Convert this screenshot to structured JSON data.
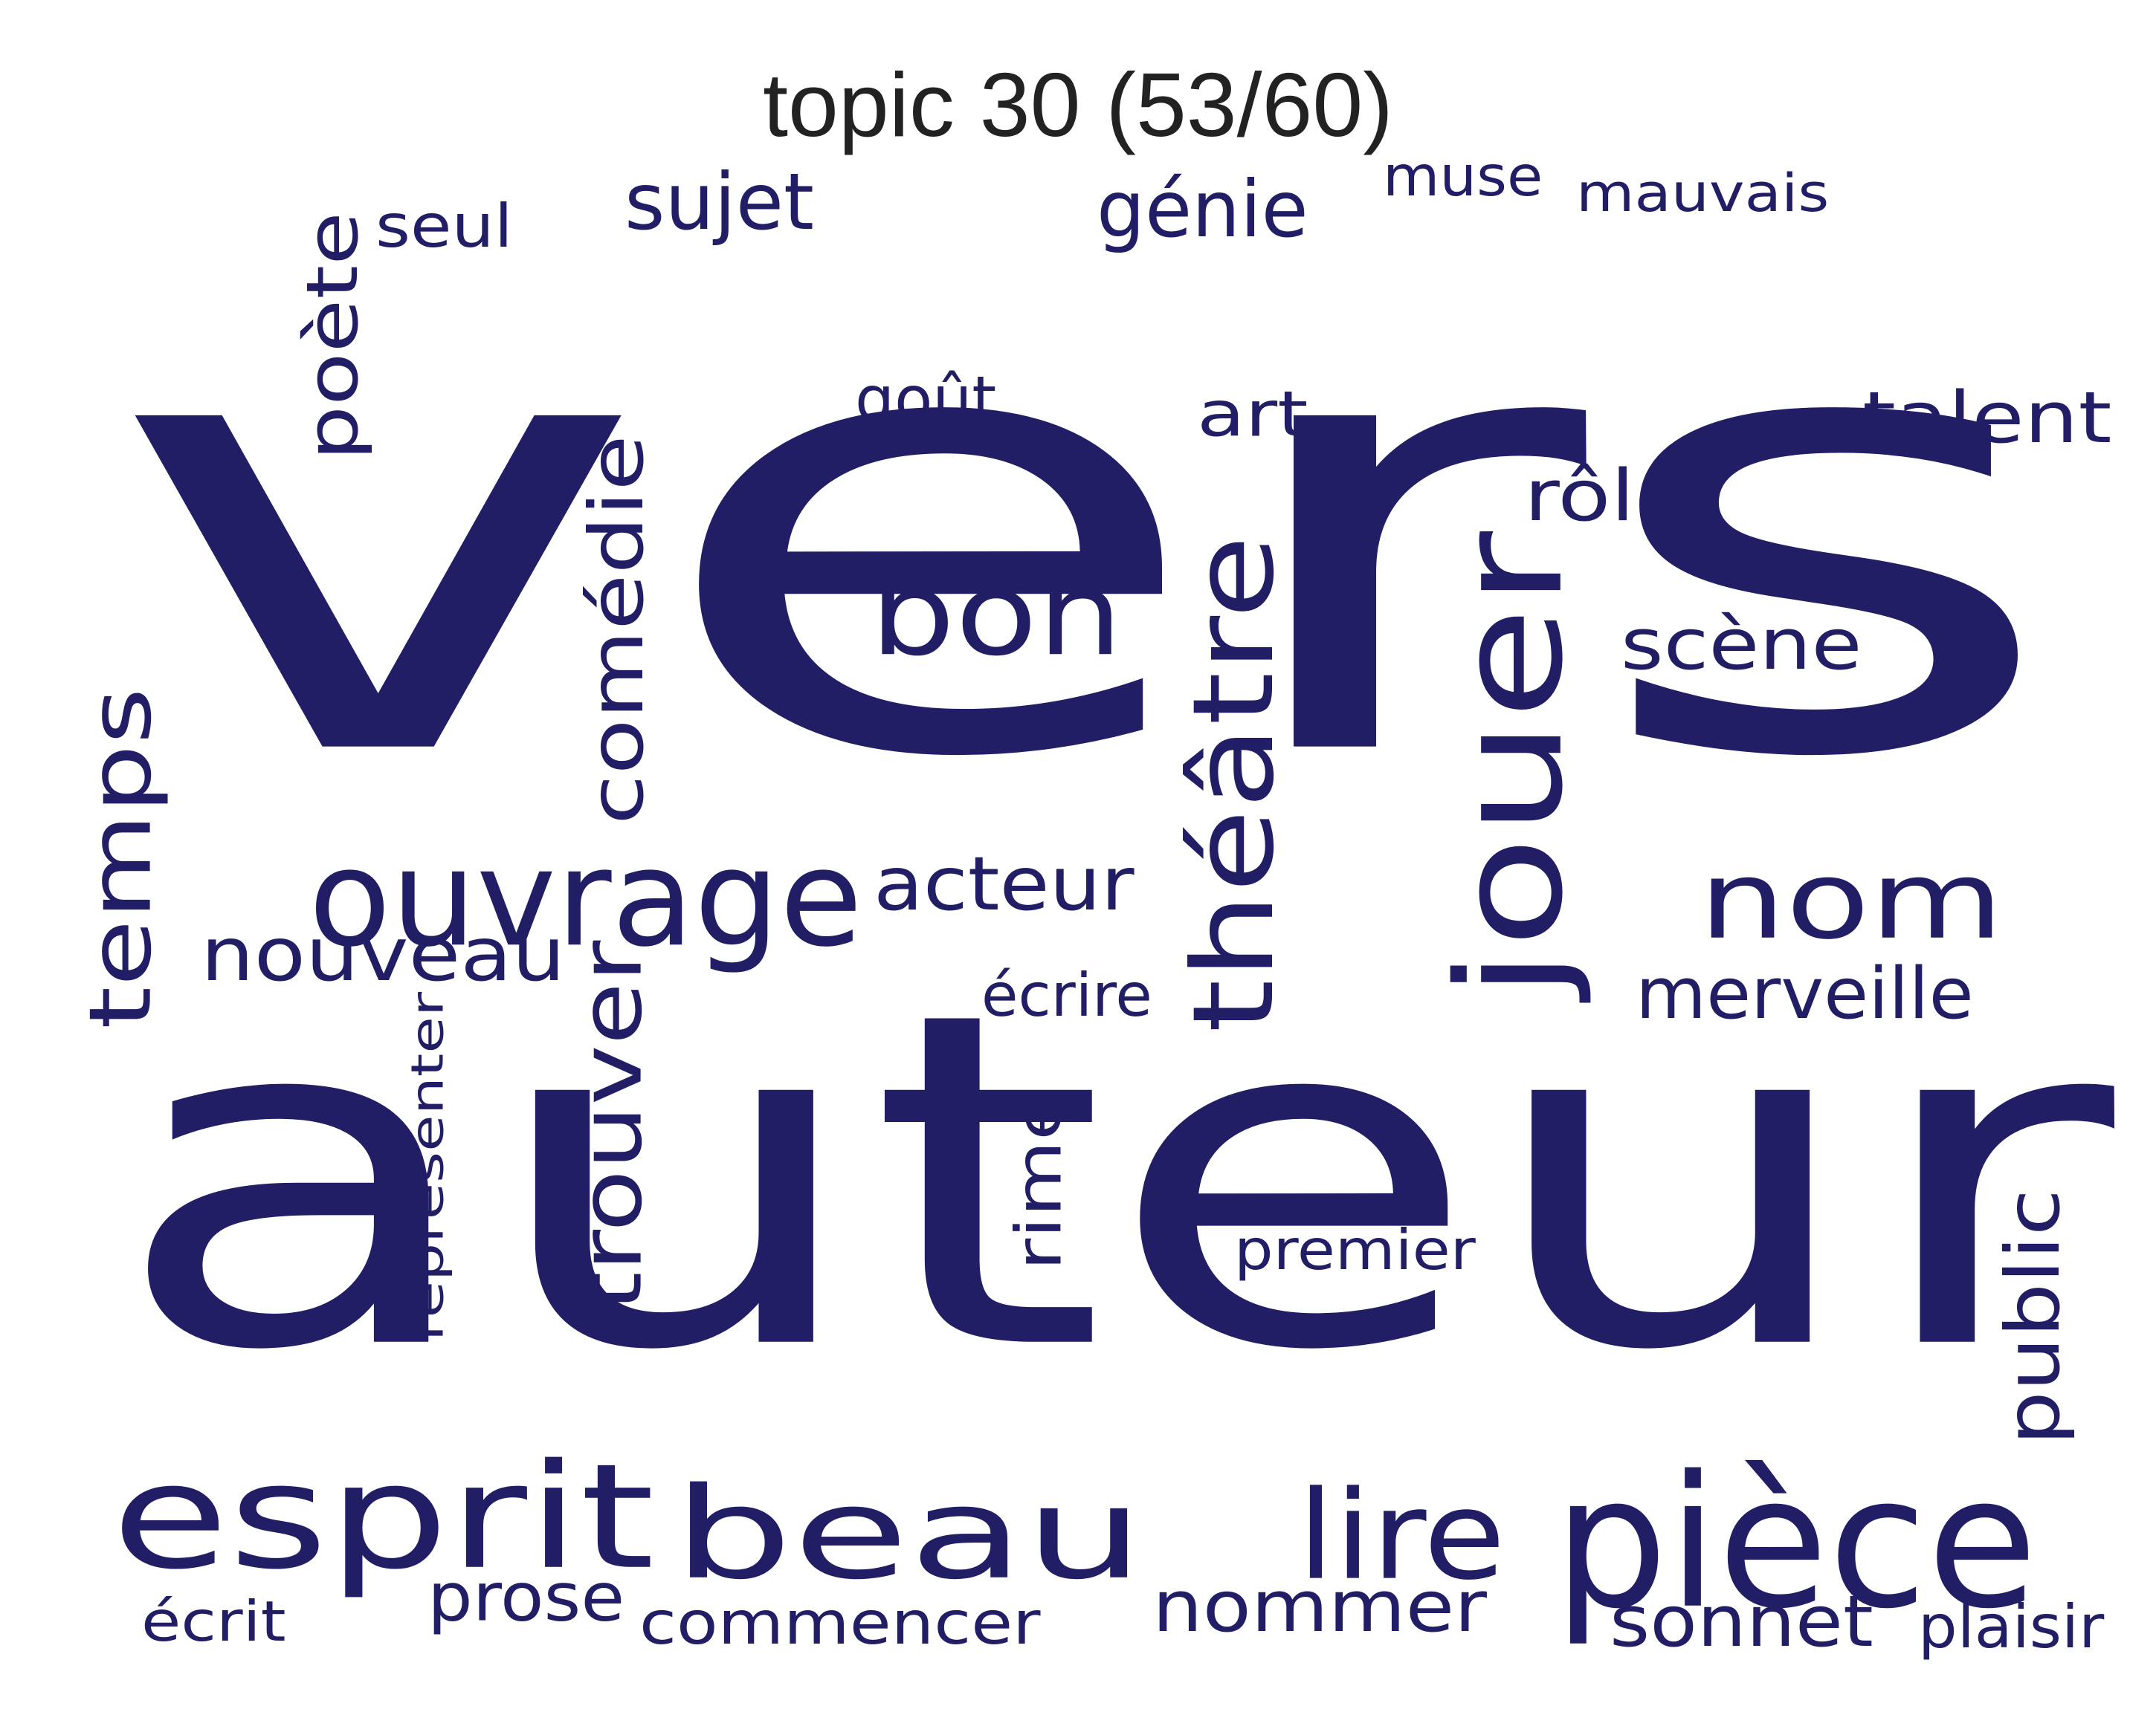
{
  "title": "topic 30 (53/60)",
  "word_color": "#221e66",
  "words": [
    {
      "text": "vers",
      "orientation": "horizontal"
    },
    {
      "text": "auteur",
      "orientation": "horizontal"
    },
    {
      "text": "esprit",
      "orientation": "horizontal"
    },
    {
      "text": "beau",
      "orientation": "horizontal"
    },
    {
      "text": "pièce",
      "orientation": "horizontal"
    },
    {
      "text": "jouer",
      "orientation": "vertical"
    },
    {
      "text": "ouvrage",
      "orientation": "horizontal"
    },
    {
      "text": "théâtre",
      "orientation": "vertical"
    },
    {
      "text": "bon",
      "orientation": "horizontal"
    },
    {
      "text": "nom",
      "orientation": "horizontal"
    },
    {
      "text": "lire",
      "orientation": "horizontal"
    },
    {
      "text": "trouver",
      "orientation": "vertical"
    },
    {
      "text": "temps",
      "orientation": "vertical"
    },
    {
      "text": "comédie",
      "orientation": "vertical"
    },
    {
      "text": "nommer",
      "orientation": "horizontal"
    },
    {
      "text": "sonnet",
      "orientation": "horizontal"
    },
    {
      "text": "nouveau",
      "orientation": "horizontal"
    },
    {
      "text": "acteur",
      "orientation": "horizontal"
    },
    {
      "text": "génie",
      "orientation": "horizontal"
    },
    {
      "text": "talent",
      "orientation": "horizontal"
    },
    {
      "text": "poète",
      "orientation": "vertical"
    },
    {
      "text": "scène",
      "orientation": "horizontal"
    },
    {
      "text": "public",
      "orientation": "vertical"
    },
    {
      "text": "sujet",
      "orientation": "horizontal"
    },
    {
      "text": "rôle",
      "orientation": "horizontal"
    },
    {
      "text": "commencer",
      "orientation": "horizontal"
    },
    {
      "text": "merveille",
      "orientation": "horizontal"
    },
    {
      "text": "art",
      "orientation": "horizontal"
    },
    {
      "text": "prose",
      "orientation": "horizontal"
    },
    {
      "text": "écrit",
      "orientation": "horizontal"
    },
    {
      "text": "rime",
      "orientation": "vertical"
    },
    {
      "text": "plaisir",
      "orientation": "horizontal"
    },
    {
      "text": "seul",
      "orientation": "horizontal"
    },
    {
      "text": "représenter",
      "orientation": "vertical"
    },
    {
      "text": "premier",
      "orientation": "horizontal"
    },
    {
      "text": "mauvais",
      "orientation": "horizontal"
    },
    {
      "text": "muse",
      "orientation": "horizontal"
    },
    {
      "text": "goût",
      "orientation": "horizontal"
    },
    {
      "text": "écrire",
      "orientation": "horizontal"
    }
  ]
}
